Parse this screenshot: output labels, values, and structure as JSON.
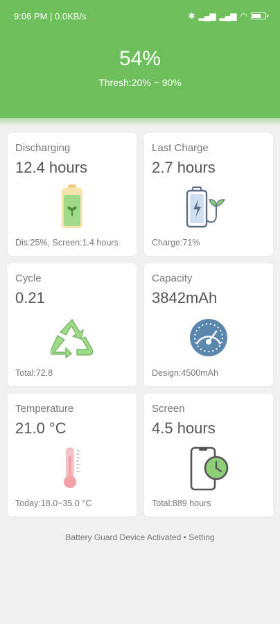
{
  "status_bar": {
    "time_speed": "9:06 PM | 0.0KB/s",
    "battery_level": 0.7
  },
  "header": {
    "percent": "54%",
    "threshold": "Thresh:20% ~ 90%"
  },
  "cards": {
    "discharging": {
      "label": "Discharging",
      "value": "12.4 hours",
      "foot": "Dis:25%, Screen:1.4 hours",
      "icon": "battery-leaf-icon"
    },
    "last_charge": {
      "label": "Last Charge",
      "value": "2.7 hours",
      "foot": "Charge:71%",
      "icon": "battery-plug-icon"
    },
    "cycle": {
      "label": "Cycle",
      "value": "0.21",
      "foot": "Total:72.8",
      "icon": "recycle-icon"
    },
    "capacity": {
      "label": "Capacity",
      "value": "3842mAh",
      "foot": "Design:4500mAh",
      "icon": "gauge-icon"
    },
    "temperature": {
      "label": "Temperature",
      "value": "21.0 °C",
      "foot": "Today:18.0~35.0 °C",
      "icon": "thermometer-icon"
    },
    "screen": {
      "label": "Screen",
      "value": "4.5 hours",
      "foot": "Total:889 hours",
      "icon": "phone-clock-icon"
    }
  },
  "footer": {
    "text": "Battery Guard Device Activated • Setting"
  },
  "colors": {
    "header_green": "#6cbf5a",
    "icon_green": "#8ccf77",
    "icon_blue": "#5b86ad",
    "thermo_pink": "#f2a1a8"
  }
}
